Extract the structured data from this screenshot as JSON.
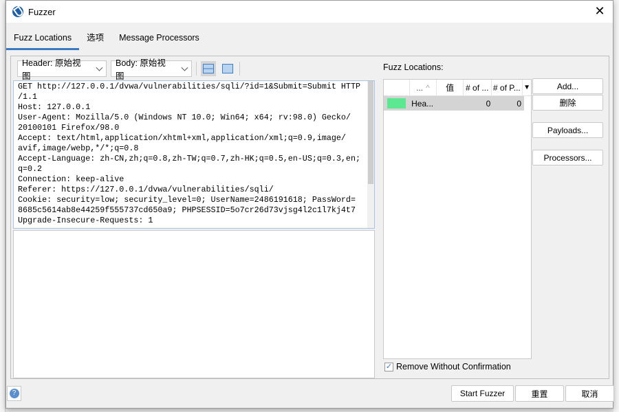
{
  "window": {
    "title": "Fuzzer",
    "close_icon": "close-icon"
  },
  "tabs": [
    {
      "label": "Fuzz Locations",
      "active": true
    },
    {
      "label": "选项"
    },
    {
      "label": "Message Processors"
    }
  ],
  "toolbar": {
    "header_view": "Header: 原始视图",
    "body_view": "Body: 原始视图"
  },
  "request_lines": [
    "GET http://127.0.0.1/dvwa/vulnerabilities/sqli/?id=1&Submit=Submit HTTP",
    "/1.1",
    "Host: 127.0.0.1",
    "User-Agent: Mozilla/5.0 (Windows NT 10.0; Win64; x64; rv:98.0) Gecko/",
    "20100101 Firefox/98.0",
    "Accept: text/html,application/xhtml+xml,application/xml;q=0.9,image/",
    "avif,image/webp,*/*;q=0.8",
    "Accept-Language: zh-CN,zh;q=0.8,zh-TW;q=0.7,zh-HK;q=0.5,en-US;q=0.3,en;",
    "q=0.2",
    "Connection: keep-alive",
    "Referer: https://127.0.0.1/dvwa/vulnerabilities/sqli/",
    "Cookie: security=low; security_level=0; UserName=2486191618; PassWord=",
    "8685c5614ab8e44259f555737cd650a9; PHPSESSID=5o7cr26d73vjsg4l2c1l7kj4t7",
    "Upgrade-Insecure-Requests: 1"
  ],
  "fuzz_locations": {
    "label": "Fuzz Locations:",
    "columns": [
      "...",
      "值",
      "# of ...",
      "# of P..."
    ],
    "rows": [
      {
        "color": "#5ce890",
        "name": "Hea...",
        "value": "",
        "count1": "0",
        "count2": "0"
      }
    ]
  },
  "buttons": {
    "add": "Add...",
    "remove": "删除",
    "payloads": "Payloads...",
    "processors": "Processors..."
  },
  "remove_without_confirmation": {
    "label": "Remove Without Confirmation",
    "checked": true
  },
  "footer": {
    "start": "Start Fuzzer",
    "reset": "重置",
    "cancel": "取消"
  }
}
